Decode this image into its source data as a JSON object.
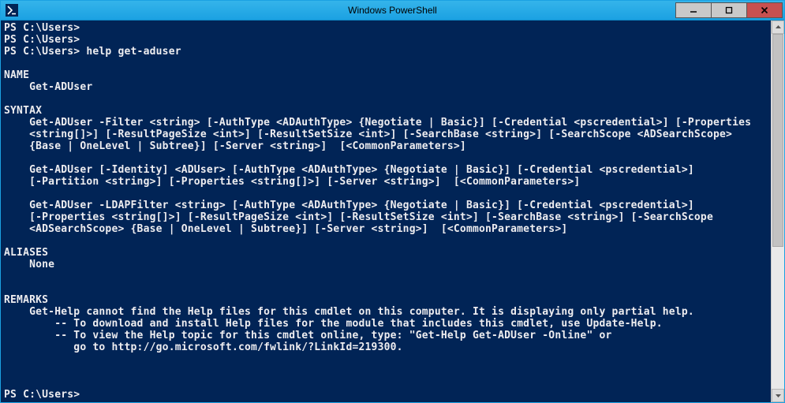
{
  "window": {
    "title": "Windows PowerShell",
    "icon": "powershell-icon",
    "controls": {
      "minimize": "–",
      "maximize": "❐",
      "close": "✕"
    }
  },
  "terminal": {
    "lines": [
      "PS C:\\Users>",
      "PS C:\\Users>",
      "PS C:\\Users> help get-aduser",
      "",
      "NAME",
      "    Get-ADUser",
      "",
      "SYNTAX",
      "    Get-ADUser -Filter <string> [-AuthType <ADAuthType> {Negotiate | Basic}] [-Credential <pscredential>] [-Properties",
      "    <string[]>] [-ResultPageSize <int>] [-ResultSetSize <int>] [-SearchBase <string>] [-SearchScope <ADSearchScope>",
      "    {Base | OneLevel | Subtree}] [-Server <string>]  [<CommonParameters>]",
      "",
      "    Get-ADUser [-Identity] <ADUser> [-AuthType <ADAuthType> {Negotiate | Basic}] [-Credential <pscredential>]",
      "    [-Partition <string>] [-Properties <string[]>] [-Server <string>]  [<CommonParameters>]",
      "",
      "    Get-ADUser -LDAPFilter <string> [-AuthType <ADAuthType> {Negotiate | Basic}] [-Credential <pscredential>]",
      "    [-Properties <string[]>] [-ResultPageSize <int>] [-ResultSetSize <int>] [-SearchBase <string>] [-SearchScope",
      "    <ADSearchScope> {Base | OneLevel | Subtree}] [-Server <string>]  [<CommonParameters>]",
      "",
      "ALIASES",
      "    None",
      "",
      "",
      "REMARKS",
      "    Get-Help cannot find the Help files for this cmdlet on this computer. It is displaying only partial help.",
      "        -- To download and install Help files for the module that includes this cmdlet, use Update-Help.",
      "        -- To view the Help topic for this cmdlet online, type: \"Get-Help Get-ADUser -Online\" or",
      "           go to http://go.microsoft.com/fwlink/?LinkId=219300.",
      "",
      "",
      "",
      "PS C:\\Users>"
    ]
  }
}
